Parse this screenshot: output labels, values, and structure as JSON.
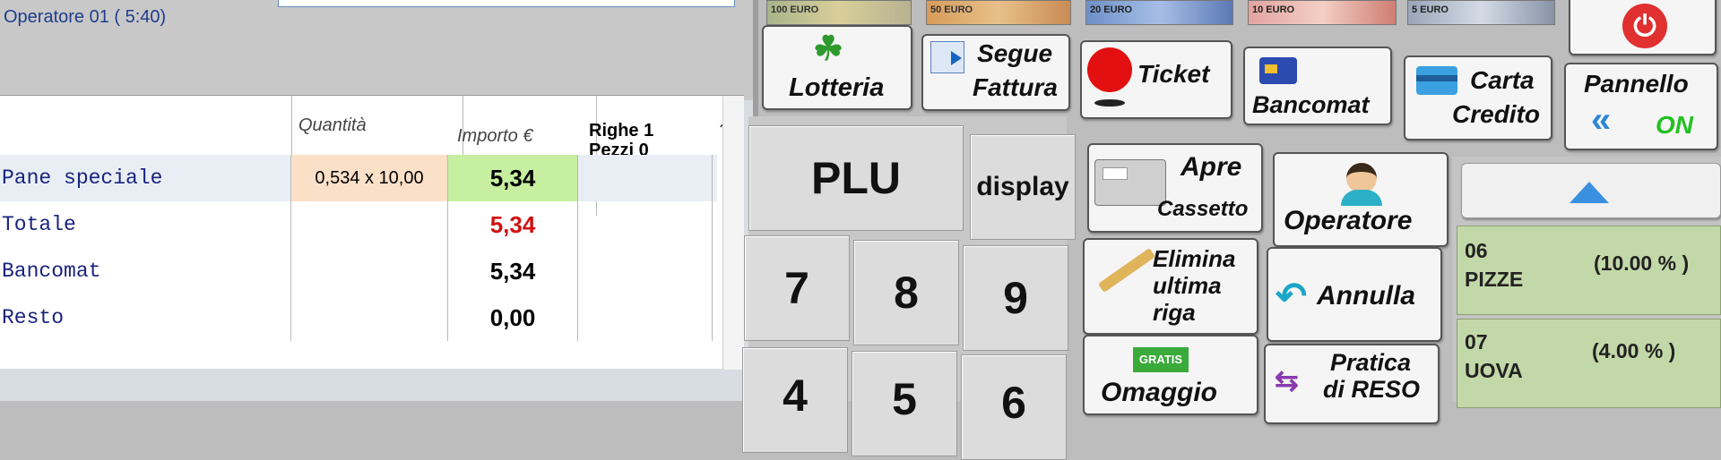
{
  "header": {
    "operator_label": "Operatore 01 ( 5:40)"
  },
  "table": {
    "columns": {
      "quantita": "Quantità",
      "importo": "Importo €"
    },
    "summary": {
      "righe": "Righe 1",
      "pezzi": "Pezzi  0"
    },
    "rows": [
      {
        "label": "Pane speciale",
        "qty": "0,534 x 10,00",
        "amount": "5,34"
      },
      {
        "label": "Totale",
        "qty": "",
        "amount": "5,34"
      },
      {
        "label": "Bancomat",
        "qty": "",
        "amount": "5,34"
      },
      {
        "label": "Resto",
        "qty": "",
        "amount": "0,00"
      }
    ]
  },
  "banknotes": [
    "100 EURO",
    "50 EURO",
    "20 EURO",
    "10 EURO",
    "5 EURO"
  ],
  "function_keys": {
    "lotteria": "Lotteria",
    "segue_1": "Segue",
    "segue_2": "Fattura",
    "ticket": "Ticket",
    "bancomat": "Bancomat",
    "carta_1": "Carta",
    "carta_2": "Credito",
    "pannello": "Pannello",
    "pannello_state": "ON",
    "apre": "Apre",
    "cassetto": "Cassetto",
    "operatore": "Operatore",
    "elimina_1": "Elimina",
    "elimina_2": "ultima",
    "elimina_3": "riga",
    "annulla": "Annulla",
    "gratis": "GRATIS",
    "omaggio": "Omaggio",
    "pratica_1": "Pratica",
    "pratica_2": "di RESO"
  },
  "keypad": {
    "plu": "PLU",
    "display": "display",
    "digits": [
      "7",
      "8",
      "9",
      "4",
      "5",
      "6"
    ]
  },
  "departments": [
    {
      "code": "06",
      "name": "PIZZE",
      "vat": "(10.00 % )"
    },
    {
      "code": "07",
      "name": "UOVA",
      "vat": "(4.00 % )"
    }
  ],
  "colors": {
    "red_total": "#d01010",
    "green_highlight": "#c6f0a0",
    "qty_highlight": "#fbe0c8",
    "department_bg": "#c3d8a8",
    "power_red": "#e03030",
    "on_green": "#22c022"
  }
}
